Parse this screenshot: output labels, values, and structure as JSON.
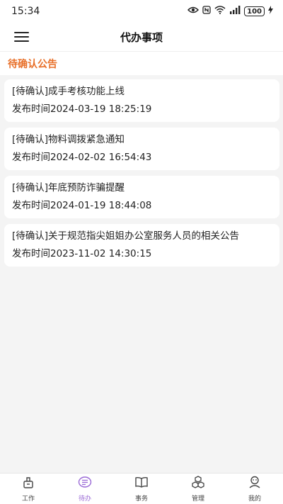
{
  "status_bar": {
    "time": "15:34",
    "battery": "100"
  },
  "header": {
    "title": "代办事项"
  },
  "section": {
    "title": "待确认公告"
  },
  "notices": [
    {
      "title": "[待确认]成手考核功能上线",
      "time": "发布时间2024-03-19 18:25:19"
    },
    {
      "title": "[待确认]物料调拨紧急通知",
      "time": "发布时间2024-02-02 16:54:43"
    },
    {
      "title": "[待确认]年底预防诈骗提醒",
      "time": "发布时间2024-01-19 18:44:08"
    },
    {
      "title": "[待确认]关于规范指尖姐姐办公室服务人员的相关公告",
      "time": "发布时间2023-11-02 14:30:15"
    }
  ],
  "nav": [
    {
      "label": "工作",
      "icon": "work-icon"
    },
    {
      "label": "待办",
      "icon": "todo-icon",
      "active": true
    },
    {
      "label": "事务",
      "icon": "book-icon"
    },
    {
      "label": "管理",
      "icon": "cubes-icon"
    },
    {
      "label": "我的",
      "icon": "user-icon"
    }
  ],
  "colors": {
    "accent": "#e8702a",
    "active_nav": "#9b6bd6",
    "background": "#f4f4f4"
  }
}
